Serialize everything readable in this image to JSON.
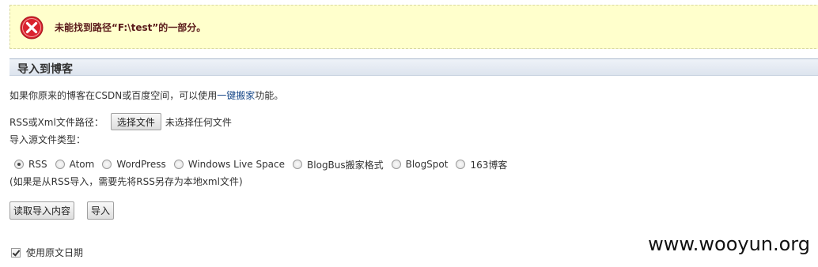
{
  "error": {
    "icon": "error-x-icon",
    "message": "未能找到路径“F:\\test”的一部分。"
  },
  "section": {
    "title": "导入到博客"
  },
  "description": {
    "before_link": "如果你原来的博客在CSDN或百度空间，可以使用",
    "link": "一键搬家",
    "after_link": "功能。"
  },
  "rss_input": {
    "label": "RSS或Xml文件路径：",
    "button": "选择文件",
    "status": "未选择任何文件"
  },
  "source_type": {
    "label": "导入源文件类型：",
    "options": [
      {
        "label": "RSS",
        "checked": true
      },
      {
        "label": "Atom",
        "checked": false
      },
      {
        "label": "WordPress",
        "checked": false
      },
      {
        "label": "Windows Live Space",
        "checked": false
      },
      {
        "label": "BlogBus搬家格式",
        "checked": false
      },
      {
        "label": "BlogSpot",
        "checked": false
      },
      {
        "label": "163博客",
        "checked": false
      }
    ],
    "note": "(如果是从RSS导入，需要先将RSS另存为本地xml文件)"
  },
  "actions": {
    "read_label": "读取导入内容",
    "import_label": "导入"
  },
  "original_date": {
    "label": "使用原文日期",
    "checked": true
  },
  "watermark": "www.wooyun.org",
  "colors": {
    "error_bg": "#ffffcc",
    "error_icon": "#d9232e",
    "link": "#1a4a8a"
  }
}
